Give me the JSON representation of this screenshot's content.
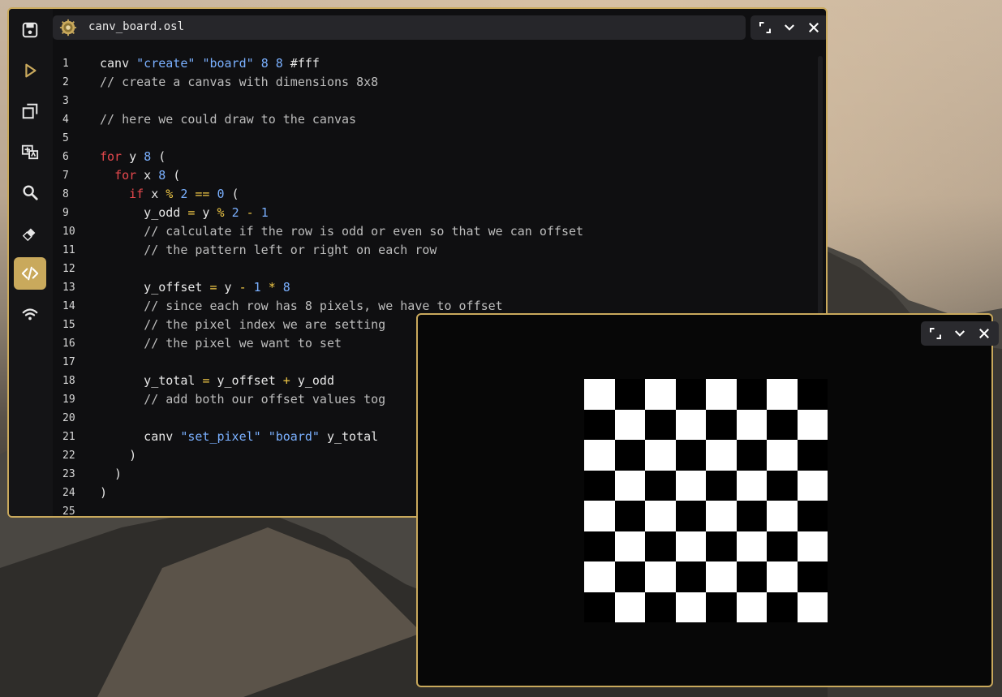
{
  "editor": {
    "filename": "canv_board.osl",
    "lines": [
      {
        "n": "1",
        "tokens": [
          [
            "t",
            "canv "
          ],
          [
            "s",
            "\"create\""
          ],
          [
            "t",
            " "
          ],
          [
            "s",
            "\"board\""
          ],
          [
            "t",
            " "
          ],
          [
            "n",
            "8"
          ],
          [
            "t",
            " "
          ],
          [
            "n",
            "8"
          ],
          [
            "t",
            " #fff"
          ]
        ]
      },
      {
        "n": "2",
        "tokens": [
          [
            "c",
            "// create a canvas with dimensions 8x8"
          ]
        ]
      },
      {
        "n": "3",
        "tokens": []
      },
      {
        "n": "4",
        "tokens": [
          [
            "c",
            "// here we could draw to the canvas"
          ]
        ]
      },
      {
        "n": "5",
        "tokens": []
      },
      {
        "n": "6",
        "tokens": [
          [
            "k",
            "for"
          ],
          [
            "t",
            " y "
          ],
          [
            "n",
            "8"
          ],
          [
            "t",
            " ("
          ]
        ]
      },
      {
        "n": "7",
        "tokens": [
          [
            "t",
            "  "
          ],
          [
            "k",
            "for"
          ],
          [
            "t",
            " x "
          ],
          [
            "n",
            "8"
          ],
          [
            "t",
            " ("
          ]
        ]
      },
      {
        "n": "8",
        "tokens": [
          [
            "t",
            "    "
          ],
          [
            "k",
            "if"
          ],
          [
            "t",
            " x "
          ],
          [
            "o",
            "%"
          ],
          [
            "t",
            " "
          ],
          [
            "n",
            "2"
          ],
          [
            "t",
            " "
          ],
          [
            "o",
            "=="
          ],
          [
            "t",
            " "
          ],
          [
            "n",
            "0"
          ],
          [
            "t",
            " ("
          ]
        ]
      },
      {
        "n": "9",
        "tokens": [
          [
            "t",
            "      y_odd "
          ],
          [
            "o",
            "="
          ],
          [
            "t",
            " y "
          ],
          [
            "o",
            "%"
          ],
          [
            "t",
            " "
          ],
          [
            "n",
            "2"
          ],
          [
            "t",
            " "
          ],
          [
            "o",
            "-"
          ],
          [
            "t",
            " "
          ],
          [
            "n",
            "1"
          ]
        ]
      },
      {
        "n": "10",
        "tokens": [
          [
            "t",
            "      "
          ],
          [
            "c",
            "// calculate if the row is odd or even so that we can offset"
          ]
        ]
      },
      {
        "n": "11",
        "tokens": [
          [
            "t",
            "      "
          ],
          [
            "c",
            "// the pattern left or right on each row"
          ]
        ]
      },
      {
        "n": "12",
        "tokens": []
      },
      {
        "n": "13",
        "tokens": [
          [
            "t",
            "      y_offset "
          ],
          [
            "o",
            "="
          ],
          [
            "t",
            " y "
          ],
          [
            "o",
            "-"
          ],
          [
            "t",
            " "
          ],
          [
            "n",
            "1"
          ],
          [
            "t",
            " "
          ],
          [
            "o",
            "*"
          ],
          [
            "t",
            " "
          ],
          [
            "n",
            "8"
          ]
        ]
      },
      {
        "n": "14",
        "tokens": [
          [
            "t",
            "      "
          ],
          [
            "c",
            "// since each row has 8 pixels, we have to offset"
          ]
        ]
      },
      {
        "n": "15",
        "tokens": [
          [
            "t",
            "      "
          ],
          [
            "c",
            "// the pixel index we are setting"
          ]
        ]
      },
      {
        "n": "16",
        "tokens": [
          [
            "t",
            "      "
          ],
          [
            "c",
            "// the pixel we want to set"
          ]
        ]
      },
      {
        "n": "17",
        "tokens": []
      },
      {
        "n": "18",
        "tokens": [
          [
            "t",
            "      y_total "
          ],
          [
            "o",
            "="
          ],
          [
            "t",
            " y_offset "
          ],
          [
            "o",
            "+"
          ],
          [
            "t",
            " y_odd"
          ]
        ]
      },
      {
        "n": "19",
        "tokens": [
          [
            "t",
            "      "
          ],
          [
            "c",
            "// add both our offset values tog"
          ]
        ]
      },
      {
        "n": "20",
        "tokens": []
      },
      {
        "n": "21",
        "tokens": [
          [
            "t",
            "      canv "
          ],
          [
            "s",
            "\"set_pixel\""
          ],
          [
            "t",
            " "
          ],
          [
            "s",
            "\"board\""
          ],
          [
            "t",
            " y_total"
          ]
        ]
      },
      {
        "n": "22",
        "tokens": [
          [
            "t",
            "    )"
          ]
        ]
      },
      {
        "n": "23",
        "tokens": [
          [
            "t",
            "  )"
          ]
        ]
      },
      {
        "n": "24",
        "tokens": [
          [
            "t",
            ")"
          ]
        ]
      },
      {
        "n": "25",
        "tokens": []
      }
    ]
  },
  "sidebar": {
    "items": [
      {
        "name": "save-icon"
      },
      {
        "name": "run-icon"
      },
      {
        "name": "windows-icon"
      },
      {
        "name": "translate-icon"
      },
      {
        "name": "search-icon"
      },
      {
        "name": "eraser-icon"
      },
      {
        "name": "code-icon",
        "active": true
      },
      {
        "name": "wifi-icon"
      }
    ]
  },
  "board": {
    "size": 8,
    "dark_color": "#000000",
    "light_color": "#ffffff"
  },
  "colors": {
    "accent": "#c9a95c"
  }
}
